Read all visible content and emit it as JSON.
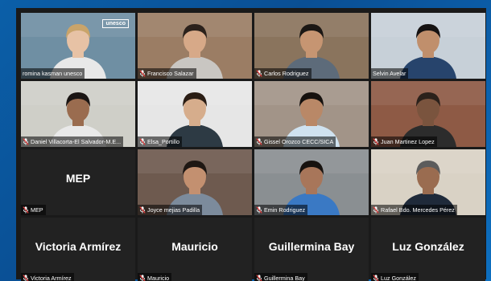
{
  "participants": [
    {
      "name": "romina kasman unesco",
      "muted": false,
      "kind": "video",
      "bg": "#6f8fa3",
      "skin": "#e7c2a5",
      "hair": "#c9a46a",
      "shirt": "#e8e8e8",
      "logo": "unesco"
    },
    {
      "name": "Francisco Salazar",
      "muted": true,
      "kind": "video",
      "bg": "#9b7d64",
      "skin": "#d7a988",
      "hair": "#2b211b",
      "shirt": "#c9c6c2"
    },
    {
      "name": "Carlos Rodriguez",
      "muted": true,
      "kind": "video",
      "bg": "#8a745d",
      "skin": "#c69572",
      "hair": "#1b1714",
      "shirt": "#5d6b7a"
    },
    {
      "name": "Selvin Avelar",
      "muted": false,
      "kind": "video",
      "bg": "#c7d0d8",
      "skin": "#c08f6c",
      "hair": "#151212",
      "shirt": "#27446c"
    },
    {
      "name": "Daniel Villacorta-El Salvador-M.E...",
      "muted": true,
      "kind": "video",
      "bg": "#cfcfc8",
      "skin": "#9a6c4f",
      "hair": "#1a1513",
      "shirt": "#e9e9e9"
    },
    {
      "name": "Elsa_Portillo",
      "muted": true,
      "kind": "video",
      "bg": "#e6e6e6",
      "skin": "#d6ad8c",
      "hair": "#2a1d14",
      "shirt": "#2d3a44"
    },
    {
      "name": "Gissel Orozco CECC/SICA",
      "muted": true,
      "kind": "video",
      "bg": "#a29488",
      "skin": "#b98867",
      "hair": "#16110e",
      "shirt": "#cfe2f0"
    },
    {
      "name": "Juan Martinez Lopez",
      "muted": true,
      "kind": "video",
      "bg": "#8e5a45",
      "skin": "#7a543e",
      "hair": "#2b211b",
      "shirt": "#2c2c2c"
    },
    {
      "name": "MEP",
      "muted": true,
      "kind": "name",
      "display": "MEP"
    },
    {
      "name": "Joyce mejias Padilla",
      "muted": true,
      "kind": "video",
      "bg": "#6e5a4f",
      "skin": "#c39070",
      "hair": "#1e1713",
      "shirt": "#7c8b9c"
    },
    {
      "name": "Emin Rodriguez",
      "muted": true,
      "kind": "video",
      "bg": "#8a8f92",
      "skin": "#a8765a",
      "hair": "#17120f",
      "shirt": "#3a79c4"
    },
    {
      "name": "Rafael Bdo. Mercedes Pérez",
      "muted": true,
      "kind": "video",
      "bg": "#d9d2c5",
      "skin": "#9a6c50",
      "hair": "#5c5c5c",
      "shirt": "#1f2a3a"
    },
    {
      "name": "Victoria Armírez",
      "muted": true,
      "kind": "name",
      "display": "Victoria Armírez"
    },
    {
      "name": "Mauricio",
      "muted": true,
      "kind": "name",
      "display": "Mauricio"
    },
    {
      "name": "Guillermina Bay",
      "muted": true,
      "kind": "name",
      "display": "Guillermina Bay"
    },
    {
      "name": "Luz González",
      "muted": true,
      "kind": "name",
      "display": "Luz González"
    }
  ]
}
